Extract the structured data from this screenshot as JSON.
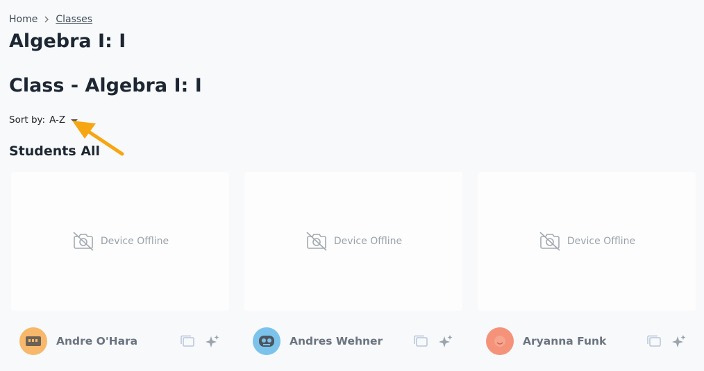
{
  "breadcrumb": {
    "home": "Home",
    "classes": "Classes"
  },
  "page_title": "Algebra I: I",
  "class_title": "Class - Algebra I: I",
  "sort": {
    "label": "Sort by:",
    "value": "A-Z"
  },
  "students_heading": "Students All",
  "colors": {
    "accent_arrow": "#f7a613",
    "offline_text": "#9aa1a9"
  },
  "students": [
    {
      "name": "Andre O'Hara",
      "status": "Device Offline",
      "avatar_color": "#f7b86b",
      "avatar_icon": "robot-face-icon"
    },
    {
      "name": "Andres Wehner",
      "status": "Device Offline",
      "avatar_color": "#7cc3ec",
      "avatar_icon": "robot-face-icon"
    },
    {
      "name": "Aryanna Funk",
      "status": "Device Offline",
      "avatar_color": "#f4937a",
      "avatar_icon": "smile-face-icon"
    }
  ]
}
